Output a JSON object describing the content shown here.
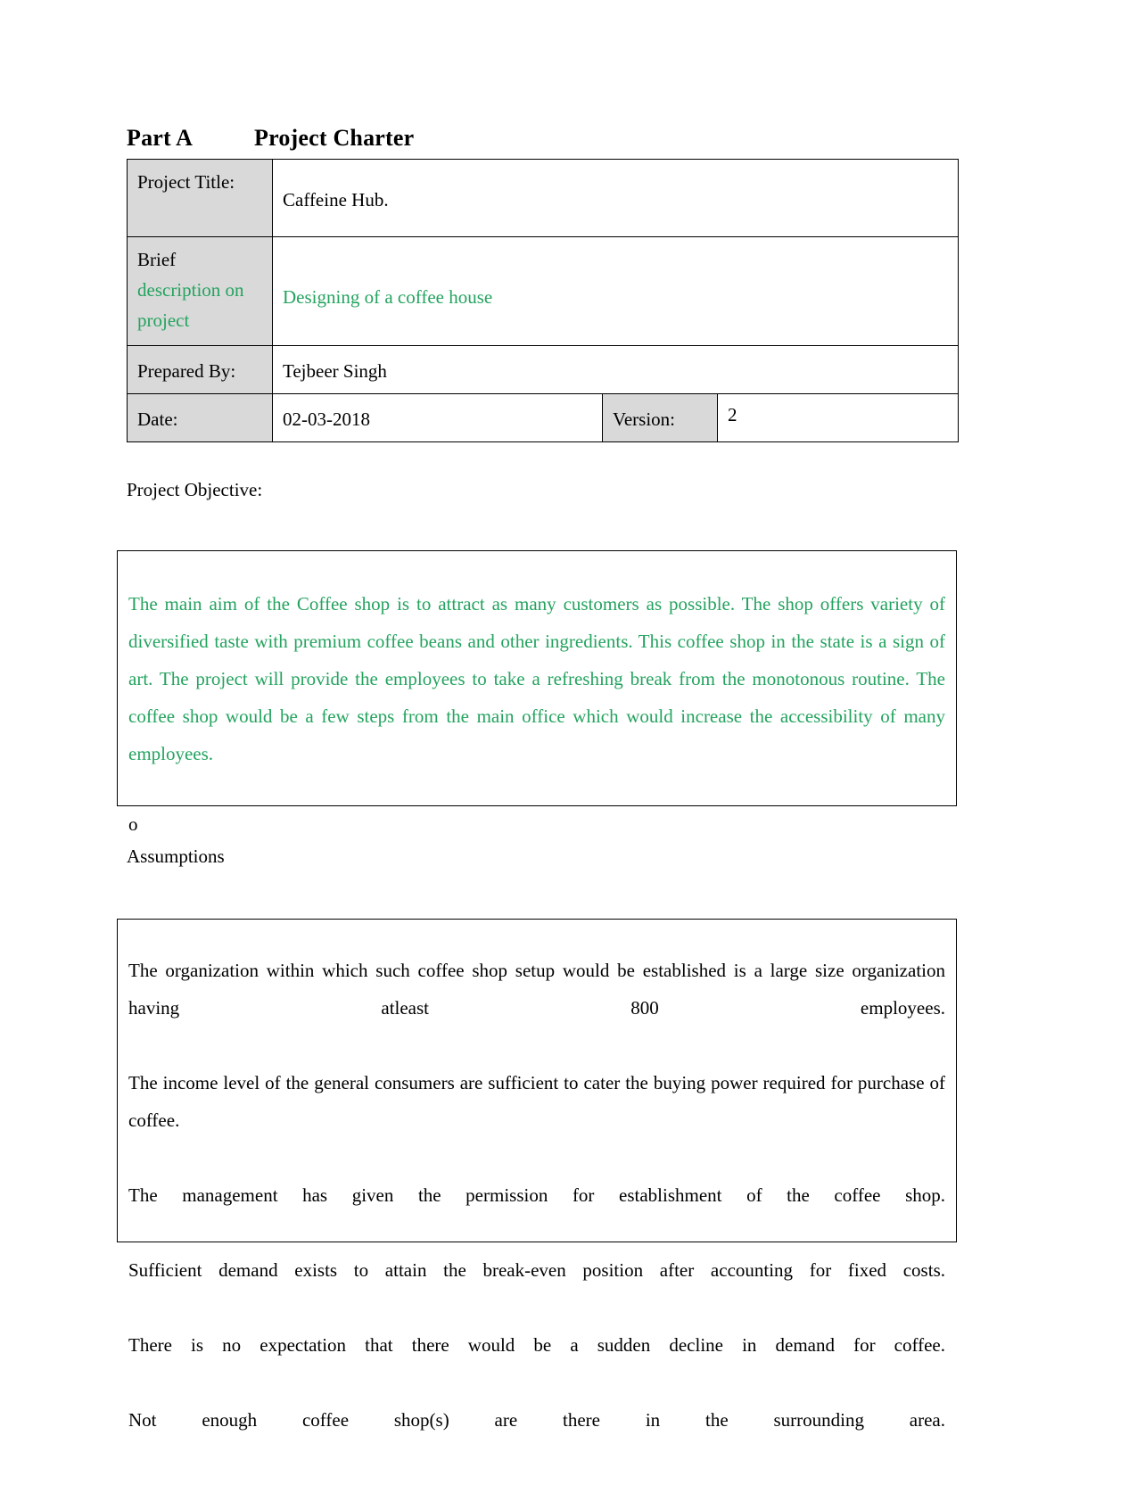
{
  "document": {
    "heading": {
      "part_label": "Part A",
      "title": "Project Charter"
    },
    "colors": {
      "green_text": "#24a35f",
      "cell_shading": "#d9d9d9",
      "border": "#000000"
    },
    "charter_table": {
      "rows": [
        {
          "label": "Project Title:",
          "value": "Caffeine Hub."
        },
        {
          "label_line1": "Brief",
          "label_line2": "description  on",
          "label_line3": "project",
          "value": "Designing of a coffee house"
        },
        {
          "label": "Prepared By:",
          "value": "Tejbeer Singh"
        },
        {
          "label": "Date:",
          "value": "02-03-2018",
          "label2": "Version:",
          "value2": "2"
        }
      ]
    },
    "objective": {
      "label": "Project Objective:",
      "text": "The main aim of the Coffee shop is to attract as many customers as possible. The shop offers variety of diversified taste with premium coffee beans and other ingredients.  This coffee shop in the state is a sign of art. The project will provide the employees to take a refreshing break from the monotonous routine. The coffee shop would be a few steps from the main office which would increase the accessibility of many employees.",
      "stray_character": "o"
    },
    "assumptions": {
      "label": "Assumptions",
      "items": [
        "The organization within which such coffee shop setup would be established is a large size organization having atleast 800 employees.",
        "The income level of the general consumers are sufficient to cater the buying power required for purchase of coffee.",
        "The management has given the permission for establishment of the coffee shop.",
        "Sufficient demand exists to attain the break-even position after accounting for fixed costs.",
        "There is no expectation that there would be a sudden decline in demand for coffee.",
        "Not enough coffee shop(s) are there in the surrounding area."
      ]
    }
  }
}
